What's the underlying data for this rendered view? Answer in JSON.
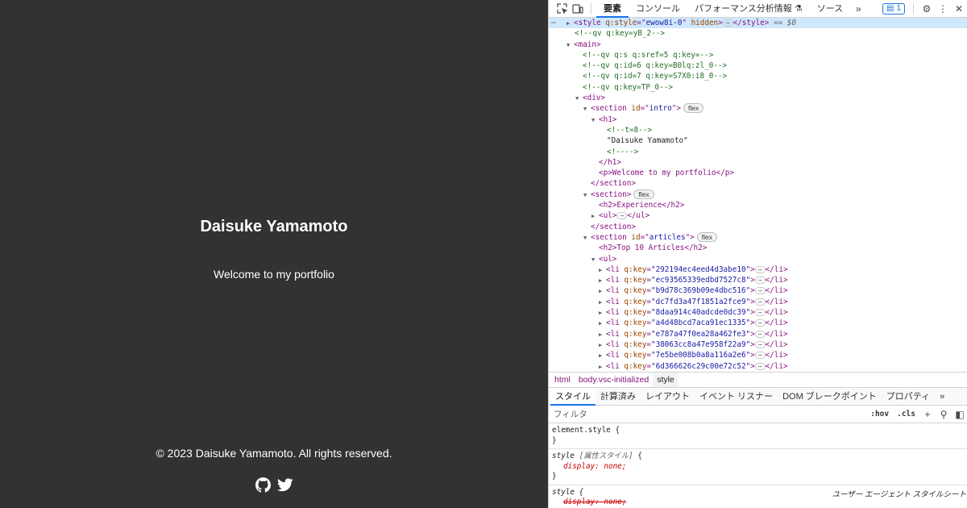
{
  "page": {
    "title": "Daisuke Yamamoto",
    "welcome": "Welcome to my portfolio",
    "copyright": "© 2023 Daisuke Yamamoto. All rights reserved.",
    "social_icons": [
      "github-icon",
      "twitter-icon"
    ],
    "background": "#323232"
  },
  "devtools": {
    "tabs": [
      "要素",
      "コンソール",
      "パフォーマンス分析情報"
    ],
    "tab_more": "ソース",
    "badge_count": "1",
    "selected_marker": "== $0",
    "dom": {
      "style_open": "<style q:style=\"ewow8i-0\" hidden>",
      "style_close": "</style>",
      "c1": "<!--qv q:key=yB_2-->",
      "main": "<main>",
      "c2": "<!--qv q:s q:sref=5 q:key=-->",
      "c3": "<!--qv q:id=6 q:key=B0lq:zl_0-->",
      "c4": "<!--qv q:id=7 q:key=S7X0:i8_0-->",
      "c5": "<!--qv q:key=TP_0-->",
      "div": "<div>",
      "intro": "<section id=\"intro\">",
      "h1": "<h1>",
      "c6": "<!--t=8-->",
      "name_text": "\"Daisuke Yamamoto\"",
      "c7": "<!---->",
      "h1_close": "</h1>",
      "p": "<p>Welcome to my portfolio</p>",
      "section_close": "</section>",
      "section2": "<section>",
      "h2_exp": "<h2>Experience</h2>",
      "ul_collapsed_open": "<ul>",
      "ul_collapsed_close": "</ul>",
      "section3": "<section id=\"articles\">",
      "h2_art": "<h2>Top 10 Articles</h2>",
      "ul_open": "<ul>",
      "flex_label": "flex",
      "li_close": "</li>",
      "li_keys": [
        "292194ec4eed4d3abe10",
        "ec93565339edbd7527c8",
        "b9d78c369b09e4dbc516",
        "dc7fd3a47f1851a2fce9",
        "8daa914c40adcde0dc39",
        "a4d48bcd7aca91ec1335",
        "e787a47f0ea28a462fe3",
        "38063cc8a47e958f22a9",
        "7e5be008b0a8a116a2e6",
        "6d366626c29c00e72c52"
      ]
    },
    "breadcrumbs": [
      "html",
      "body.vsc-initialized",
      "style"
    ],
    "subtabs": [
      "スタイル",
      "計算済み",
      "レイアウト",
      "イベント リスナー",
      "DOM ブレークポイント",
      "プロパティ"
    ],
    "filter": {
      "placeholder": "フィルタ",
      "hov": ":hov",
      "cls": ".cls"
    },
    "styles": {
      "element_style": "element.style {",
      "close_brace": "}",
      "rule2_selector": "style",
      "rule2_source": "[属性スタイル]",
      "rule2_open": "{",
      "display_prop": "display: none;",
      "rule3_selector": "style {",
      "rule3_origin": "ユーザー エージェント スタイルシート"
    }
  }
}
